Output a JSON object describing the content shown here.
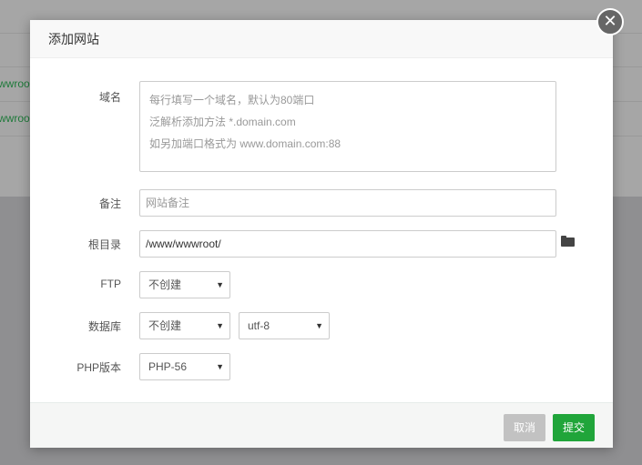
{
  "background": {
    "rows": [
      "wwroo",
      "wwroo"
    ]
  },
  "dialog": {
    "title": "添加网站",
    "close_icon": "close-icon",
    "domain": {
      "label": "域名",
      "placeholder_lines": [
        "每行填写一个域名，默认为80端口",
        "泛解析添加方法 *.domain.com",
        "如另加端口格式为 www.domain.com:88"
      ]
    },
    "note": {
      "label": "备注",
      "placeholder": "网站备注"
    },
    "root": {
      "label": "根目录",
      "value": "/www/wwwroot/",
      "icon": "folder-open-icon"
    },
    "ftp": {
      "label": "FTP",
      "selected": "不创建"
    },
    "database": {
      "label": "数据库",
      "selected": "不创建",
      "charset": "utf-8"
    },
    "php": {
      "label": "PHP版本",
      "selected": "PHP-56"
    },
    "buttons": {
      "cancel": "取消",
      "submit": "提交"
    },
    "colors": {
      "submit": "#20a53a",
      "cancel": "#c2c2c2"
    }
  }
}
